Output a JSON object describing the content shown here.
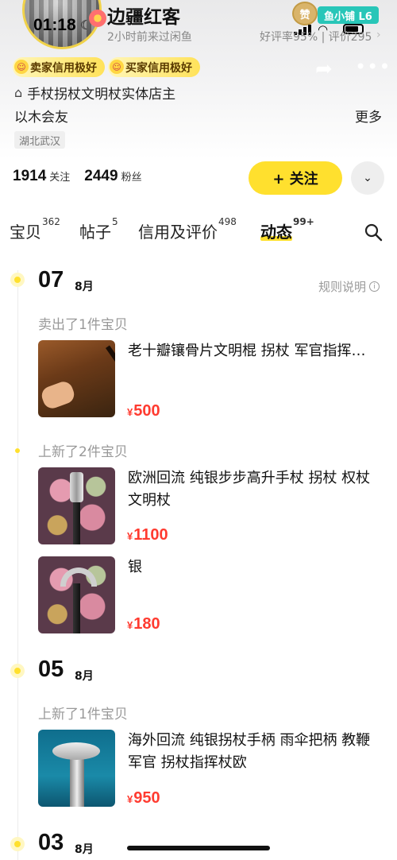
{
  "status_bar": {
    "time": "01:18"
  },
  "profile": {
    "name": "边疆红客",
    "praise_badge": "赞",
    "level_badge": "鱼小铺 L6",
    "last_active": "2小时前来过闲鱼",
    "rating": "好评率95% | 评价295",
    "credit_badges": [
      "卖家信用极好",
      "买家信用极好"
    ],
    "shop_desc": "手杖拐杖文明杖实体店主",
    "bio": "以木会友",
    "more_label": "更多",
    "location": "湖北武汉",
    "stats": {
      "following_count": "1914",
      "following_label": "关注",
      "fans_count": "2449",
      "fans_label": "粉丝"
    },
    "follow_label": "+ 关注"
  },
  "tabs": [
    {
      "label": "宝贝",
      "count": "362",
      "active": false
    },
    {
      "label": "帖子",
      "count": "5",
      "active": false
    },
    {
      "label": "信用及评价",
      "count": "498",
      "active": false
    },
    {
      "label": "动态",
      "count": "99+",
      "active": true
    }
  ],
  "timeline": {
    "rules_label": "规则说明",
    "groups": [
      {
        "day": "07",
        "month": "8月",
        "events": [
          {
            "label": "卖出了1件宝贝",
            "items": [
              {
                "title": "老十瓣镶骨片文明棍 拐杖 军官指挥…",
                "price": "500"
              }
            ]
          },
          {
            "label": "上新了2件宝贝",
            "items": [
              {
                "title": "欧洲回流 纯银步步高升手杖 拐杖 权杖 文明杖",
                "price": "1100"
              },
              {
                "title": "银",
                "price": "180"
              }
            ]
          }
        ]
      },
      {
        "day": "05",
        "month": "8月",
        "events": [
          {
            "label": "上新了1件宝贝",
            "items": [
              {
                "title": "海外回流 纯银拐杖手柄 雨伞把柄 教鞭 军官 拐杖指挥杖欧",
                "price": "950"
              }
            ]
          }
        ]
      },
      {
        "day": "03",
        "month": "8月",
        "events": []
      }
    ]
  },
  "currency_symbol": "¥",
  "accent_color": "#ffe02e",
  "price_color": "#ff3b30"
}
